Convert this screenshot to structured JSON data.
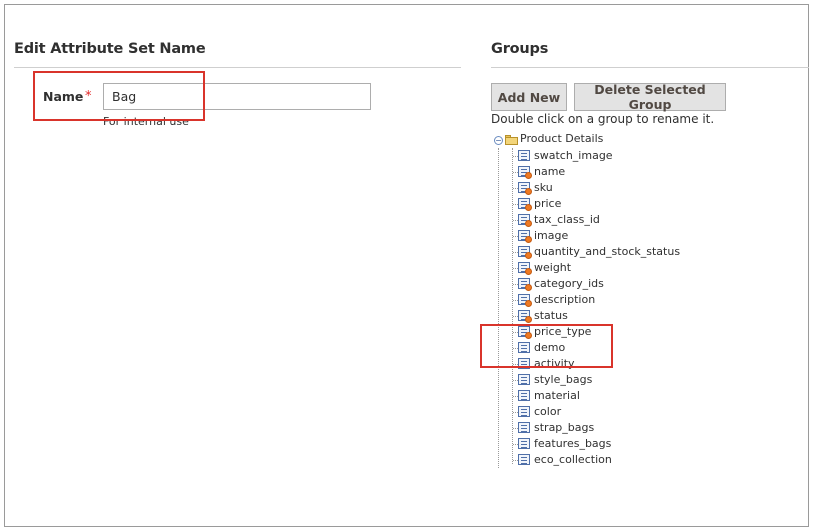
{
  "attribute_set": {
    "title": "Edit Attribute Set Name",
    "name_label": "Name",
    "required_marker": "*",
    "name_value": "Bag",
    "hint": "For internal use"
  },
  "groups": {
    "title": "Groups",
    "add_new_label": "Add New",
    "delete_label": "Delete Selected Group",
    "hint": "Double click on a group to rename it.",
    "root": "Product Details",
    "attributes": [
      {
        "label": "swatch_image",
        "system": false
      },
      {
        "label": "name",
        "system": true
      },
      {
        "label": "sku",
        "system": true
      },
      {
        "label": "price",
        "system": true
      },
      {
        "label": "tax_class_id",
        "system": true
      },
      {
        "label": "image",
        "system": true
      },
      {
        "label": "quantity_and_stock_status",
        "system": true
      },
      {
        "label": "weight",
        "system": true
      },
      {
        "label": "category_ids",
        "system": true
      },
      {
        "label": "description",
        "system": true
      },
      {
        "label": "status",
        "system": true
      },
      {
        "label": "price_type",
        "system": true
      },
      {
        "label": "demo",
        "system": false
      },
      {
        "label": "activity",
        "system": false
      },
      {
        "label": "style_bags",
        "system": false
      },
      {
        "label": "material",
        "system": false
      },
      {
        "label": "color",
        "system": false
      },
      {
        "label": "strap_bags",
        "system": false
      },
      {
        "label": "features_bags",
        "system": false
      },
      {
        "label": "eco_collection",
        "system": false
      }
    ]
  },
  "colors": {
    "callout": "#d9342b",
    "required": "#e22626",
    "button_bg": "#e3e3e3",
    "system_dot": "#ef7a23"
  }
}
